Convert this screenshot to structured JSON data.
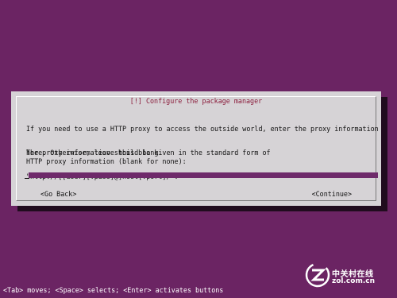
{
  "dialog": {
    "title": "[!] Configure the package manager",
    "paragraph1_line1": "If you need to use a HTTP proxy to access the outside world, enter the proxy information",
    "paragraph1_line2": "here. Otherwise, leave this blank.",
    "paragraph2_line1": "The proxy information should be given in the standard form of",
    "paragraph2_line2": "\"http://[[user][:pass]@]host[:port]/\".",
    "field_label": "HTTP proxy information (blank for none):",
    "field_value": "",
    "go_back_label": "<Go Back>",
    "continue_label": "<Continue>"
  },
  "statusbar": {
    "text": "<Tab> moves; <Space> selects; <Enter> activates buttons"
  },
  "watermark": {
    "brand_cn": "中关村在线",
    "brand_en": "zol.com.cn"
  },
  "colors": {
    "background": "#6b2463",
    "dialog": "#d6d3d6",
    "input": "#6e2a6a",
    "title": "#8a1a3a"
  }
}
